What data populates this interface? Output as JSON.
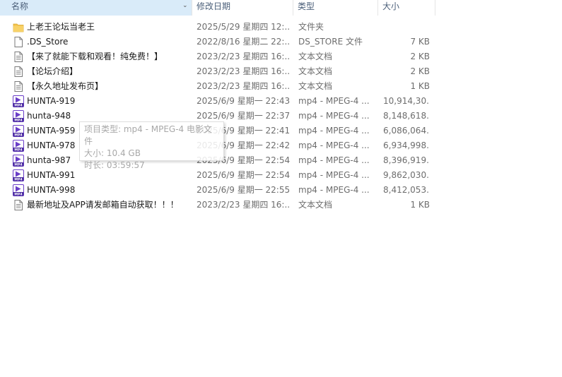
{
  "columns": {
    "name": "名称",
    "date": "修改日期",
    "type": "类型",
    "size": "大小"
  },
  "files": [
    {
      "icon": "folder-icon",
      "name": "上老王论坛当老王",
      "date": "2025/5/29 星期四 12:...",
      "type": "文件夹",
      "size": ""
    },
    {
      "icon": "file-icon",
      "name": ".DS_Store",
      "date": "2022/8/16 星期二 22:...",
      "type": "DS_STORE 文件",
      "size": "7 KB"
    },
    {
      "icon": "text-document-icon",
      "name": "【来了就能下载和观看！纯免费！】",
      "date": "2023/2/23 星期四 16:...",
      "type": "文本文档",
      "size": "2 KB"
    },
    {
      "icon": "text-document-icon",
      "name": "【论坛介绍】",
      "date": "2023/2/23 星期四 16:...",
      "type": "文本文档",
      "size": "2 KB"
    },
    {
      "icon": "text-document-icon",
      "name": "【永久地址发布页】",
      "date": "2023/2/23 星期四 16:...",
      "type": "文本文档",
      "size": "1 KB"
    },
    {
      "icon": "mp4-video-icon",
      "name": "HUNTA-919",
      "date": "2025/6/9 星期一 22:43",
      "type": "mp4 - MPEG-4 ...",
      "size": "10,914,30..."
    },
    {
      "icon": "mp4-video-icon",
      "name": "hunta-948",
      "date": "2025/6/9 星期一 22:37",
      "type": "mp4 - MPEG-4 ...",
      "size": "8,148,618..."
    },
    {
      "icon": "mp4-video-icon",
      "name": "HUNTA-959",
      "date": "2025/6/9 星期一 22:41",
      "type": "mp4 - MPEG-4 ...",
      "size": "6,086,064..."
    },
    {
      "icon": "mp4-video-icon",
      "name": "HUNTA-978",
      "date": "2025/6/9 星期一 22:42",
      "type": "mp4 - MPEG-4 ...",
      "size": "6,934,998..."
    },
    {
      "icon": "mp4-video-icon",
      "name": "hunta-987",
      "date": "2025/6/9 星期一 22:54",
      "type": "mp4 - MPEG-4 ...",
      "size": "8,396,919..."
    },
    {
      "icon": "mp4-video-icon",
      "name": "HUNTA-991",
      "date": "2025/6/9 星期一 22:54",
      "type": "mp4 - MPEG-4 ...",
      "size": "9,862,030..."
    },
    {
      "icon": "mp4-video-icon",
      "name": "HUNTA-998",
      "date": "2025/6/9 星期一 22:55",
      "type": "mp4 - MPEG-4 ...",
      "size": "8,412,053..."
    },
    {
      "icon": "text-document-icon",
      "name": "最新地址及APP请发邮箱自动获取！！！",
      "date": "2023/2/23 星期四 16:...",
      "type": "文本文档",
      "size": "1 KB"
    }
  ],
  "tooltip": {
    "type_line": "项目类型: mp4 - MPEG-4 电影文件",
    "size_line": "大小: 10.4 GB",
    "duration_line": "时长: 03:59:57"
  },
  "colors": {
    "header_active_bg": "#d9ebf9",
    "header_text": "#4c607a",
    "folder": "#f3c34d",
    "mp4_icon": "#6a3dc8"
  }
}
